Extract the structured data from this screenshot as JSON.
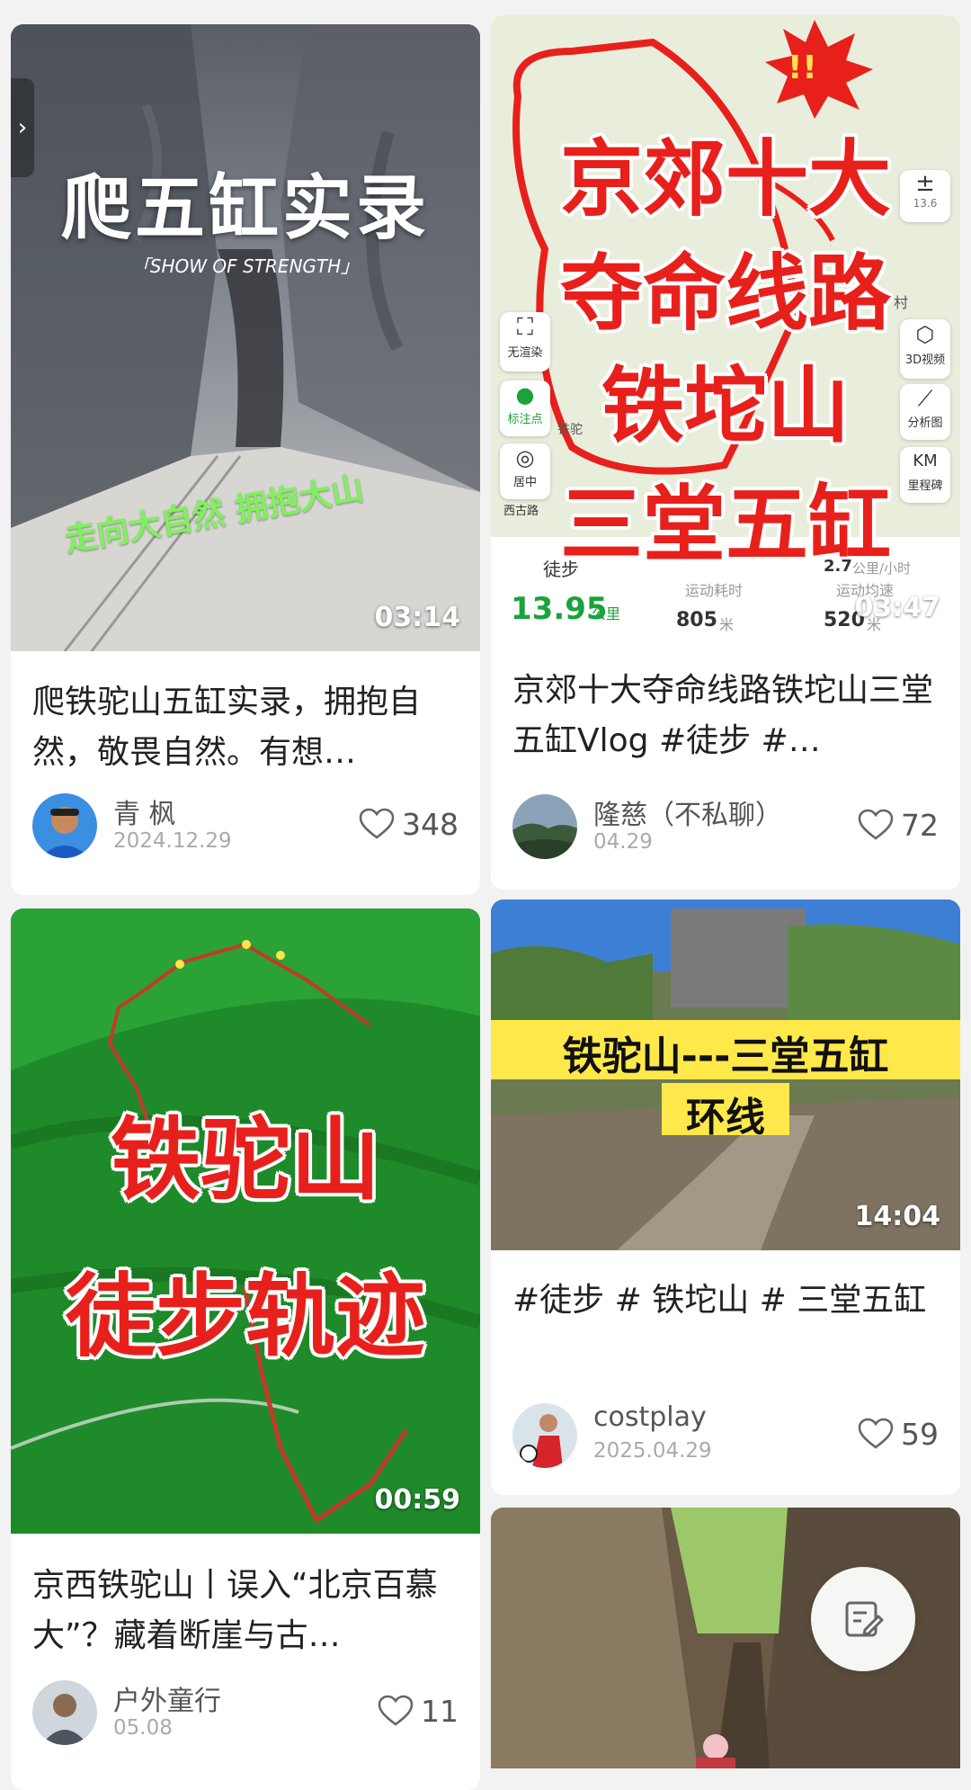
{
  "feed": {
    "cards": [
      {
        "cover_title": "爬五缸实录",
        "cover_subtitle": "「SHOW OF STRENGTH」",
        "cover_slogan": "走向大自然  拥抱大山",
        "duration": "03:14",
        "title": "爬铁驼山五缸实录，拥抱自然，敬畏自然。有想…",
        "author": "青 枫",
        "date": "2024.12.29",
        "likes": "348"
      },
      {
        "cover_lines": [
          "京郊十大",
          "夺命线路",
          "铁坨山",
          "三堂五缸"
        ],
        "map_controls": {
          "zoom": "13.6",
          "no_render": "无渲染",
          "mark": "标注点",
          "center": "居中",
          "view3d": "3D视频",
          "analysis": "分析图",
          "km": "KM",
          "milestone": "里程碑",
          "road": "西古路",
          "poi": "铁驼",
          "village": "村"
        },
        "stats": {
          "mode": "徒步",
          "distance": "13.95",
          "distance_unit": "公里",
          "elapsed_label": "运动耗时",
          "speed_label": "运动均速",
          "climb": "805",
          "climb_unit": "米",
          "descent": "520",
          "descent_unit": "米",
          "speed_value": "2.7",
          "speed_unit": "公里/小时"
        },
        "badge": "!!",
        "duration": "03:47",
        "title": "京郊十大夺命线路铁坨山三堂五缸Vlog #徒步 #…",
        "author": "隆慈（不私聊）",
        "date": "04.29",
        "likes": "72"
      },
      {
        "cover_lines": [
          "铁驼山",
          "徒步轨迹"
        ],
        "duration": "00:59",
        "title": "京西铁驼山丨误入“北京百慕大”？藏着断崖与古…",
        "author": "户外童行",
        "date": "05.08",
        "likes": "11"
      },
      {
        "cover_lines": [
          "铁驼山---三堂五缸",
          "环线"
        ],
        "duration": "14:04",
        "title": "#徒步 # 铁坨山 # 三堂五缸",
        "author": "costplay",
        "date": "2025.04.29",
        "likes": "59"
      }
    ]
  },
  "colors": {
    "background": "#f2f2f2",
    "accent_red": "#e8201c",
    "slogan_green": "#7ef25a",
    "distance_green": "#1aa33a"
  },
  "icons": {
    "like": "heart-outline-icon",
    "compose": "edit-note-icon",
    "back": "chevron-left-icon"
  }
}
